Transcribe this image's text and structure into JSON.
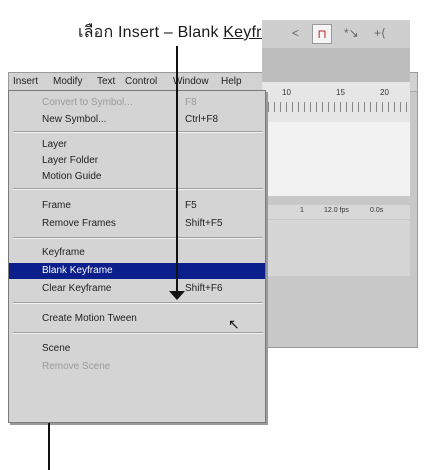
{
  "caption": {
    "prefix": "เลือก Insert – Blank ",
    "underlined": "Keyframe"
  },
  "menubar": {
    "items": [
      "Insert",
      "Modify",
      "Text",
      "Control",
      "Window",
      "Help"
    ]
  },
  "insert_menu": {
    "items": [
      {
        "label": "Convert to Symbol...",
        "shortcut": "F8"
      },
      {
        "label": "New Symbol...",
        "shortcut": "Ctrl+F8"
      },
      {
        "label": "Layer",
        "shortcut": ""
      },
      {
        "label": "Layer Folder",
        "shortcut": ""
      },
      {
        "label": "Motion Guide",
        "shortcut": ""
      },
      {
        "label": "Frame",
        "shortcut": "F5"
      },
      {
        "label": "Remove Frames",
        "shortcut": "Shift+F5"
      },
      {
        "label": "Keyframe",
        "shortcut": ""
      },
      {
        "label": "Blank Keyframe",
        "shortcut": ""
      },
      {
        "label": "Clear Keyframe",
        "shortcut": "Shift+F6"
      },
      {
        "label": "Create Motion Tween",
        "shortcut": ""
      },
      {
        "label": "Scene",
        "shortcut": ""
      },
      {
        "label": "Remove Scene",
        "shortcut": ""
      }
    ]
  },
  "timeline": {
    "ruler_numbers": [
      "10",
      "15",
      "20"
    ],
    "status": [
      "1",
      "12.0 fps",
      "0.0s"
    ]
  },
  "icons": {
    "toolbar_button": "snap-icon"
  }
}
